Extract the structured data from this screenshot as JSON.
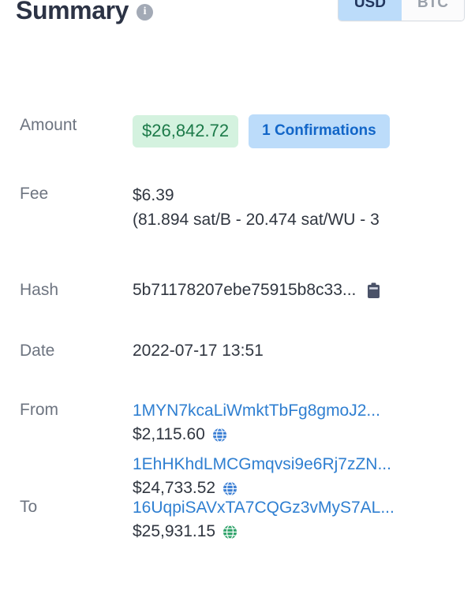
{
  "header": {
    "title": "Summary",
    "info_icon": "info-icon",
    "currency_toggle": {
      "options": [
        {
          "label": "USD",
          "selected": true
        },
        {
          "label": "BTC",
          "selected": false
        }
      ]
    }
  },
  "rows": {
    "amount": {
      "label": "Amount",
      "value": "$26,842.72",
      "confirmations": "1 Confirmations"
    },
    "fee": {
      "label": "Fee",
      "value": "$6.39",
      "rate": "(81.894 sat/B - 20.474 sat/WU - 3"
    },
    "hash": {
      "label": "Hash",
      "value": "5b71178207ebe75915b8c33...",
      "copy_icon": "clipboard-icon"
    },
    "date": {
      "label": "Date",
      "value": "2022-07-17 13:51"
    },
    "from": {
      "label": "From",
      "entries": [
        {
          "address": "1MYN7kcaLiWmktTbFg8gmoJ2...",
          "amount": "$2,115.60",
          "globe_icon": "globe-icon"
        },
        {
          "address": "1EhHKhdLMCGmqvsi9e6Rj7zZN...",
          "amount": "$24,733.52",
          "globe_icon": "globe-icon"
        }
      ]
    },
    "to": {
      "label": "To",
      "entries": [
        {
          "address": "16UqpiSAVxTA7CQGz3vMyS7AL...",
          "amount": "$25,931.15",
          "globe_icon": "globe-icon"
        }
      ]
    }
  },
  "colors": {
    "title": "#2c3345",
    "label": "#6d7480",
    "value": "#303640",
    "link": "#2f7fd1",
    "amount_badge_bg": "#d4f2df",
    "amount_badge_text": "#1c7a49",
    "confirm_badge_bg": "#bcdcfa",
    "confirm_badge_text": "#1266c8",
    "toggle_active_bg": "#bcdcfa",
    "globe_from": "#3b7fd4",
    "globe_to": "#2fa36a"
  }
}
